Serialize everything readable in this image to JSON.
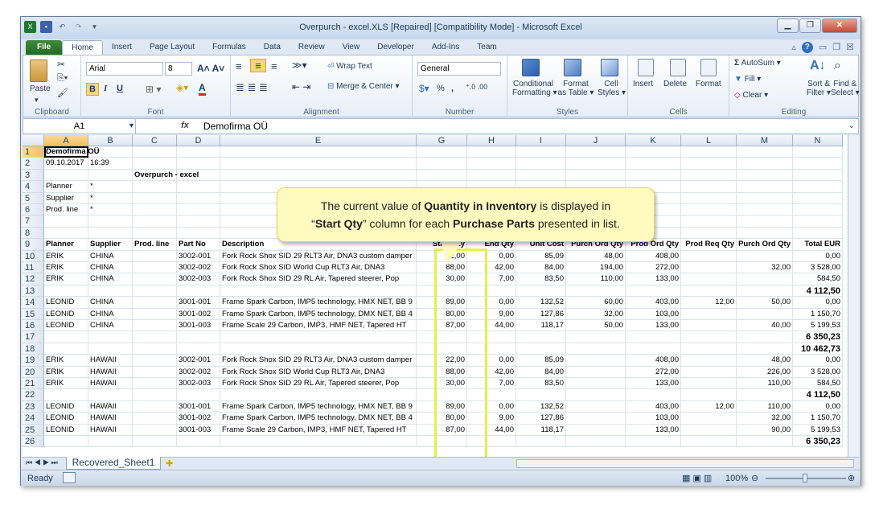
{
  "window": {
    "title": "Overpurch - excel.XLS [Repaired]  [Compatibility Mode]  -  Microsoft Excel"
  },
  "tabs": [
    "File",
    "Home",
    "Insert",
    "Page Layout",
    "Formulas",
    "Data",
    "Review",
    "View",
    "Developer",
    "Add-Ins",
    "Team"
  ],
  "ribbon": {
    "clipboard": {
      "paste": "Paste",
      "label": "Clipboard"
    },
    "font": {
      "name": "Arial",
      "size": "8",
      "label": "Font",
      "bold": "B",
      "italic": "I",
      "underline": "U"
    },
    "alignment": {
      "wrap": "Wrap Text",
      "merge": "Merge & Center",
      "label": "Alignment"
    },
    "number": {
      "format": "General",
      "label": "Number",
      "pct": "%",
      "comma": ","
    },
    "styles": {
      "cond": "Conditional Formatting",
      "table": "Format as Table",
      "cell": "Cell Styles",
      "label": "Styles",
      "cond1": "Conditional",
      "cond2": "Formatting",
      "table1": "Format",
      "table2": "as Table",
      "cell1": "Cell",
      "cell2": "Styles"
    },
    "cells": {
      "insert": "Insert",
      "delete": "Delete",
      "format": "Format",
      "label": "Cells"
    },
    "editing": {
      "autosum": "AutoSum",
      "fill": "Fill",
      "clear": "Clear",
      "sort1": "Sort &",
      "sort2": "Filter",
      "find1": "Find &",
      "find2": "Select",
      "label": "Editing"
    }
  },
  "formula": {
    "namebox": "A1",
    "fx": "fx",
    "value": "Demofirma OÜ"
  },
  "columns": [
    "A",
    "B",
    "C",
    "D",
    "E",
    "G",
    "H",
    "I",
    "J",
    "K",
    "L",
    "M",
    "N"
  ],
  "rows": [
    [
      "1",
      "Demofirma OÜ",
      "",
      "",
      "",
      "",
      "",
      "",
      "",
      "",
      "",
      "",
      "",
      ""
    ],
    [
      "2",
      "09.10.2017",
      "16:39",
      "",
      "",
      "",
      "",
      "",
      "",
      "",
      "",
      "",
      "",
      ""
    ],
    [
      "3",
      "",
      "",
      "Overpurch - excel",
      "",
      "",
      "",
      "",
      "",
      "",
      "",
      "",
      "",
      ""
    ],
    [
      "4",
      "Planner",
      "*",
      "",
      "",
      "",
      "",
      "",
      "",
      "",
      "",
      "",
      "",
      ""
    ],
    [
      "5",
      "Supplier",
      "*",
      "",
      "",
      "",
      "",
      "",
      "",
      "",
      "",
      "",
      "",
      ""
    ],
    [
      "6",
      "Prod. line",
      "*",
      "",
      "",
      "",
      "",
      "",
      "",
      "",
      "",
      "",
      "",
      ""
    ],
    [
      "7",
      "",
      "",
      "",
      "",
      "",
      "",
      "",
      "",
      "",
      "",
      "",
      "",
      ""
    ],
    [
      "8",
      "",
      "",
      "",
      "",
      "",
      "",
      "",
      "",
      "",
      "",
      "",
      "",
      ""
    ],
    [
      "9",
      "Planner",
      "Supplier",
      "Prod. line",
      "Part No",
      "Description",
      "Start Qty",
      "End Qty",
      "Unit Cost",
      "Purch Ord Qty",
      "Prod Ord Qty",
      "Prod Req Qty",
      "Purch Ord Qty",
      "Total EUR"
    ],
    [
      "10",
      "ERIK",
      "CHINA",
      "",
      "3002-001",
      "Fork Rock Shox SID 29 RLT3 Air, DNA3 custom damper",
      "22,00",
      "0,00",
      "85,09",
      "48,00",
      "408,00",
      "",
      "",
      "0,00"
    ],
    [
      "11",
      "ERIK",
      "CHINA",
      "",
      "3002-002",
      "Fork Rock Shox SID World Cup RLT3 Air, DNA3",
      "88,00",
      "42,00",
      "84,00",
      "194,00",
      "272,00",
      "",
      "32,00",
      "3 528,00"
    ],
    [
      "12",
      "ERIK",
      "CHINA",
      "",
      "3002-003",
      "Fork Rock Shox SID 29 RL Air, Tapered steerer, Pop",
      "30,00",
      "7,00",
      "83,50",
      "110,00",
      "133,00",
      "",
      "",
      "584,50"
    ],
    [
      "13",
      "",
      "",
      "",
      "",
      "",
      "",
      "",
      "",
      "",
      "",
      "",
      "",
      "4 112,50"
    ],
    [
      "14",
      "LEONID",
      "CHINA",
      "",
      "3001-001",
      "Frame Spark Carbon, IMP5 technology, HMX NET, BB 9",
      "89,00",
      "0,00",
      "132,52",
      "60,00",
      "403,00",
      "12,00",
      "50,00",
      "0,00"
    ],
    [
      "15",
      "LEONID",
      "CHINA",
      "",
      "3001-002",
      "Frame Spark Carbon, IMP5 technology, DMX NET, BB 4",
      "80,00",
      "9,00",
      "127,86",
      "32,00",
      "103,00",
      "",
      "",
      "1 150,70"
    ],
    [
      "16",
      "LEONID",
      "CHINA",
      "",
      "3001-003",
      "Frame Scale 29 Carbon, IMP3, HMF NET, Tapered HT",
      "87,00",
      "44,00",
      "118,17",
      "50,00",
      "133,00",
      "",
      "40,00",
      "5 199,53"
    ],
    [
      "17",
      "",
      "",
      "",
      "",
      "",
      "",
      "",
      "",
      "",
      "",
      "",
      "",
      "6 350,23"
    ],
    [
      "18",
      "",
      "",
      "",
      "",
      "",
      "",
      "",
      "",
      "",
      "",
      "",
      "",
      "10 462,73"
    ],
    [
      "19",
      "ERIK",
      "HAWAII",
      "",
      "3002-001",
      "Fork Rock Shox SID 29 RLT3 Air, DNA3 custom damper",
      "22,00",
      "0,00",
      "85,09",
      "",
      "408,00",
      "",
      "48,00",
      "0,00"
    ],
    [
      "20",
      "ERIK",
      "HAWAII",
      "",
      "3002-002",
      "Fork Rock Shox SID World Cup RLT3 Air, DNA3",
      "88,00",
      "42,00",
      "84,00",
      "",
      "272,00",
      "",
      "226,00",
      "3 528,00"
    ],
    [
      "21",
      "ERIK",
      "HAWAII",
      "",
      "3002-003",
      "Fork Rock Shox SID 29 RL Air, Tapered steerer, Pop",
      "30,00",
      "7,00",
      "83,50",
      "",
      "133,00",
      "",
      "110,00",
      "584,50"
    ],
    [
      "22",
      "",
      "",
      "",
      "",
      "",
      "",
      "",
      "",
      "",
      "",
      "",
      "",
      "4 112,50"
    ],
    [
      "23",
      "LEONID",
      "HAWAII",
      "",
      "3001-001",
      "Frame Spark Carbon, IMP5 technology, HMX NET, BB 9",
      "89,00",
      "0,00",
      "132,52",
      "",
      "403,00",
      "12,00",
      "110,00",
      "0,00"
    ],
    [
      "24",
      "LEONID",
      "HAWAII",
      "",
      "3001-002",
      "Frame Spark Carbon, IMP5 technology, DMX NET, BB 4",
      "80,00",
      "9,00",
      "127,86",
      "",
      "103,00",
      "",
      "32,00",
      "1 150,70"
    ],
    [
      "25",
      "LEONID",
      "HAWAII",
      "",
      "3001-003",
      "Frame Scale 29 Carbon, IMP3, HMF NET, Tapered HT",
      "87,00",
      "44,00",
      "118,17",
      "",
      "133,00",
      "",
      "90,00",
      "5 199,53"
    ],
    [
      "26",
      "",
      "",
      "",
      "",
      "",
      "",
      "",
      "",
      "",
      "",
      "",
      "",
      "6 350,23"
    ]
  ],
  "callout": {
    "p1": "The current value of ",
    "b1": "Quantity in Inventory",
    "p2": " is displayed in",
    "p3": "“",
    "b2": "Start Qty",
    "p4": "” column for each ",
    "b3": "Purchase Parts",
    "p5": " presented in list."
  },
  "sheet": {
    "tab": "Recovered_Sheet1"
  },
  "status": {
    "ready": "Ready",
    "zoom": "100%"
  }
}
